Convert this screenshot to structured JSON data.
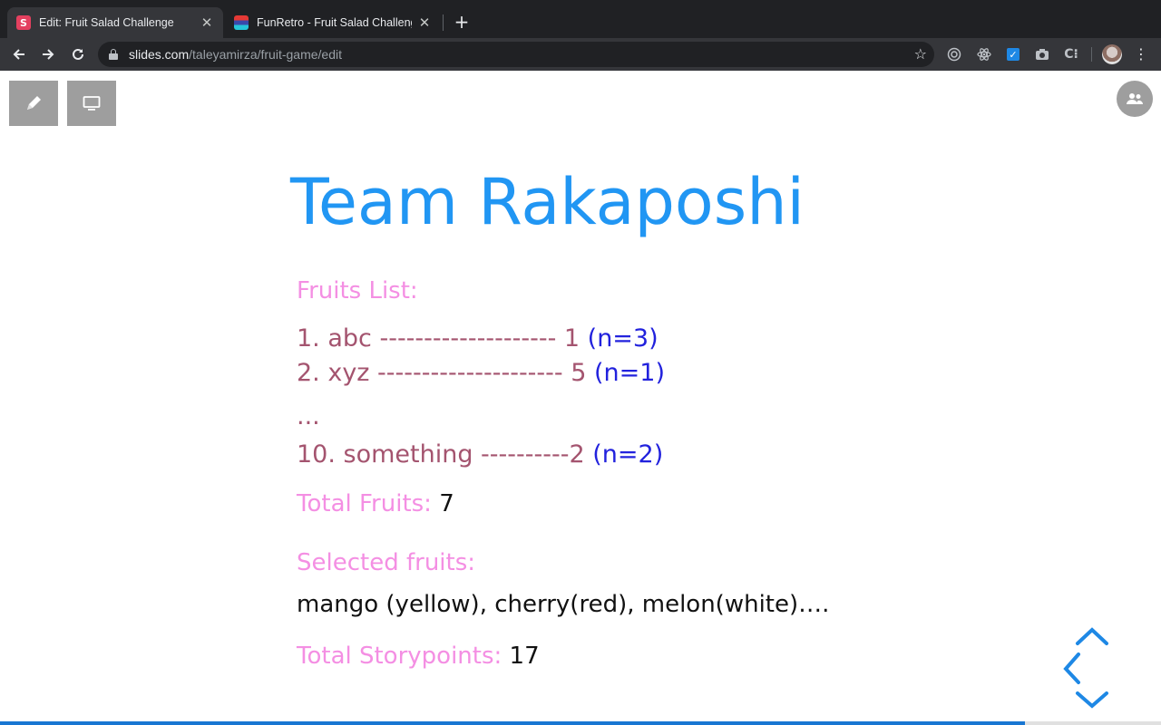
{
  "browser": {
    "tabs": [
      {
        "title": "Edit: Fruit Salad Challenge",
        "favicon": "slides-favicon",
        "active": true
      },
      {
        "title": "FunRetro - Fruit Salad Challenge",
        "favicon": "funretro-favicon",
        "active": false
      }
    ],
    "favicon_letter": "S",
    "url_host": "slides.com",
    "url_path": "/taleyamirza/fruit-game/edit"
  },
  "slide": {
    "title": "Team Rakaposhi",
    "fruits_list_label": "Fruits List:",
    "items": [
      {
        "text": " 1. abc -------------------- 1 ",
        "count": "(n=3)"
      },
      {
        "text": " 2. xyz --------------------- 5 ",
        "count": "(n=1)"
      },
      {
        "text": "...",
        "count": ""
      },
      {
        "text": "10. something ----------2 ",
        "count": "(n=2)"
      }
    ],
    "total_fruits_label": "Total Fruits:",
    "total_fruits_value": "7",
    "selected_fruits_label": "Selected fruits:",
    "selected_fruits_value": "mango (yellow), cherry(red), melon(white)….",
    "total_storypoints_label": "Total Storypoints:",
    "total_storypoints_value": "17"
  },
  "colors": {
    "title": "#2196f3",
    "label_pink": "#f48fe3",
    "item_plum": "#a4546f",
    "count_blue": "#2222dd",
    "progress": "#1976d2"
  }
}
